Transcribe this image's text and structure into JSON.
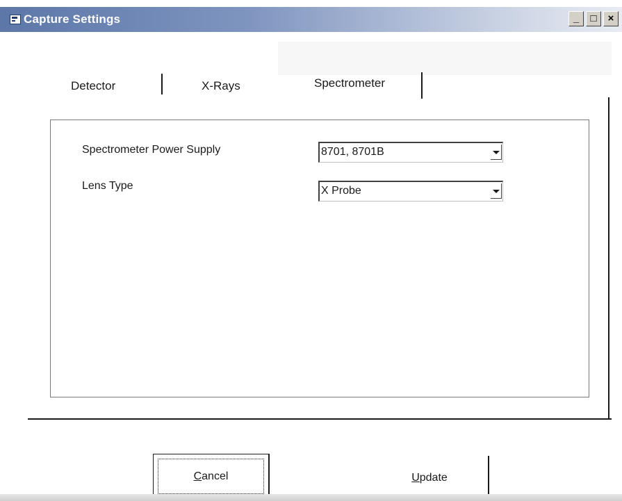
{
  "window": {
    "title": "Capture Settings",
    "title_icon": "form-icon",
    "controls": {
      "minimize": "_",
      "maximize": "□",
      "close": "×"
    }
  },
  "tabs": [
    {
      "label": "Detector",
      "selected": false
    },
    {
      "label": "X-Rays",
      "selected": false
    },
    {
      "label": "Spectrometer",
      "selected": true
    }
  ],
  "fields": [
    {
      "label": "Spectrometer Power Supply",
      "value": "8701, 8701B"
    },
    {
      "label": "Lens Type",
      "value": "X Probe"
    }
  ],
  "buttons": {
    "cancel": {
      "accel": "C",
      "rest": "ancel"
    },
    "update": {
      "accel": "U",
      "rest": "pdate"
    }
  },
  "colors": {
    "titlebar_start": "#5c77a8",
    "titlebar_end": "#e8ebf2",
    "title_text": "#ffffff"
  }
}
